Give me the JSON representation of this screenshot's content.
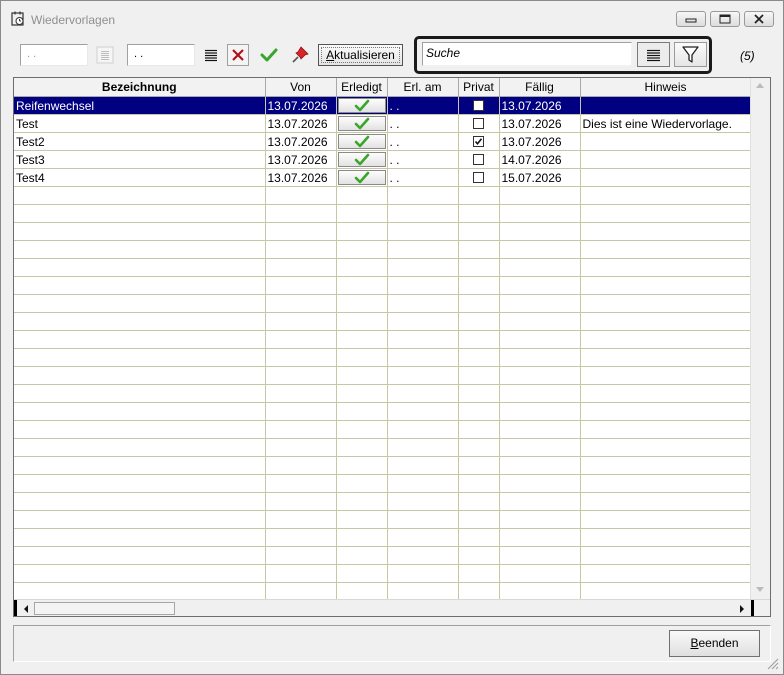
{
  "window": {
    "title": "Wiedervorlagen"
  },
  "toolbar": {
    "date_from": ". .",
    "date_to": ". .",
    "refresh_label": "Aktualisieren",
    "refresh_accel": "A",
    "search_placeholder": "Suche",
    "count": "(5)"
  },
  "grid": {
    "columns": [
      "Bezeichnung",
      "Von",
      "Erledigt",
      "Erl. am",
      "Privat",
      "Fällig",
      "Hinweis"
    ],
    "rows": [
      {
        "bezeichnung": "Reifenwechsel",
        "von": "13.07.2026",
        "erledigt": "done",
        "erl_am": ". .",
        "privat": false,
        "faellig": "13.07.2026",
        "hinweis": ""
      },
      {
        "bezeichnung": "Test",
        "von": "13.07.2026",
        "erledigt": "done",
        "erl_am": ". .",
        "privat": false,
        "faellig": "13.07.2026",
        "hinweis": "Dies ist eine Wiedervorlage."
      },
      {
        "bezeichnung": "Test2",
        "von": "13.07.2026",
        "erledigt": "done",
        "erl_am": ". .",
        "privat": true,
        "faellig": "13.07.2026",
        "hinweis": ""
      },
      {
        "bezeichnung": "Test3",
        "von": "13.07.2026",
        "erledigt": "done",
        "erl_am": ". .",
        "privat": false,
        "faellig": "14.07.2026",
        "hinweis": ""
      },
      {
        "bezeichnung": "Test4",
        "von": "13.07.2026",
        "erledigt": "done",
        "erl_am": ". .",
        "privat": false,
        "faellig": "15.07.2026",
        "hinweis": ""
      }
    ],
    "selected_row": 0
  },
  "footer": {
    "close_label": "Beenden",
    "close_accel": "B"
  },
  "icons": {
    "app": "calendar-clock-icon",
    "minimize": "minimize-icon",
    "maximize": "maximize-icon",
    "close": "close-icon",
    "list": "list-icon",
    "clear": "red-x-icon",
    "confirm": "green-check-icon",
    "pin": "red-pin-icon",
    "filter": "funnel-icon"
  },
  "colors": {
    "selection": "#000080",
    "grid_line": "#c7c7a6",
    "check_green": "#3aa52c",
    "pin_red": "#d8242a",
    "clear_red": "#b0121a"
  }
}
